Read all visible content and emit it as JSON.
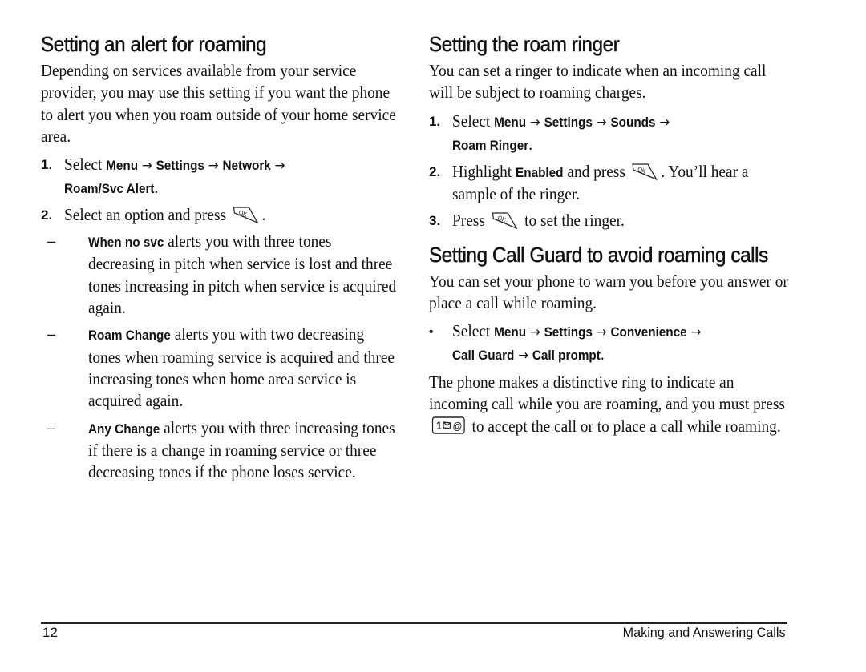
{
  "left": {
    "heading": "Setting an alert for roaming",
    "intro": "Depending on services available from your service provider, you may use this setting if you want the phone to alert you when you roam outside of your home service area.",
    "steps": [
      {
        "number": "1.",
        "prefix": "Select ",
        "path": [
          "Menu",
          "Settings",
          "Network",
          "Roam/Svc Alert"
        ],
        "suffix": "."
      },
      {
        "number": "2.",
        "prefix": "Select an option and press",
        "key_icon": "ok-key-icon",
        "suffix": "."
      }
    ],
    "options": [
      {
        "dash": "–",
        "name": "When no svc",
        "text": " alerts you with three tones decreasing in pitch when service is lost and three tones increasing in pitch when service is acquired again."
      },
      {
        "dash": "–",
        "name": "Roam Change",
        "text": " alerts you with two decreasing tones when roaming service is acquired and three increasing tones when home area service is acquired again."
      },
      {
        "dash": "–",
        "name": "Any Change",
        "text": " alerts you with three increasing tones if there is a change in roaming service or three decreasing tones if the phone loses service."
      }
    ]
  },
  "right": {
    "roam_ringer": {
      "heading": "Setting the roam ringer",
      "intro": "You can set a ringer to indicate when an incoming call will be subject to roaming charges.",
      "steps": [
        {
          "number": "1.",
          "prefix": "Select ",
          "path": [
            "Menu",
            "Settings",
            "Sounds",
            "Roam Ringer"
          ],
          "suffix": "."
        },
        {
          "number": "2.",
          "prefix": "Highlight ",
          "bold": "Enabled",
          "middle": " and press",
          "key_icon": "ok-key-icon",
          "suffix": ". You’ll hear a sample of the ringer."
        },
        {
          "number": "3.",
          "prefix": "Press",
          "key_icon": "ok-key-icon",
          "suffix": " to set the ringer."
        }
      ]
    },
    "call_guard": {
      "heading": "Setting Call Guard to avoid roaming calls",
      "intro": "You can set your phone to warn you before you answer or place a call while roaming.",
      "bullet": {
        "marker": "•",
        "prefix": "Select ",
        "path": [
          "Menu",
          "Settings",
          "Convenience",
          "Call Guard",
          "Call prompt"
        ],
        "suffix": "."
      },
      "closing_before": "The phone makes a distinctive ring to indicate an incoming call while you are roaming, and you must press",
      "closing_key_icon": "one-voicemail-key-icon",
      "closing_key_label": "1",
      "closing_after": " to accept the call or to place a call while roaming."
    }
  },
  "arrow_glyph": "→",
  "footer": {
    "page_number": "12",
    "chapter_title": "Making and Answering Calls"
  }
}
